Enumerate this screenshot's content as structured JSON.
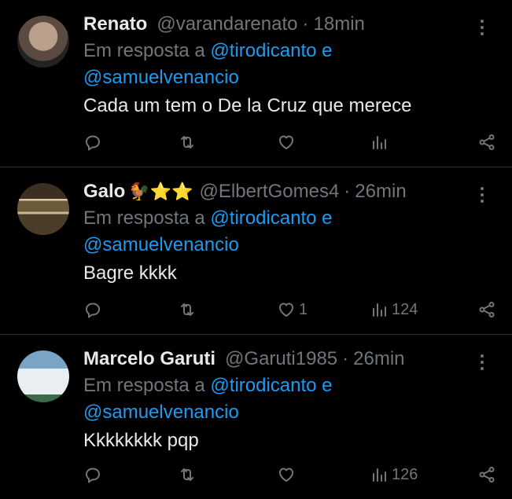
{
  "replies": [
    {
      "name": "Renato",
      "emoji": "",
      "handle": "@varandarenato",
      "sep": "·",
      "time": "18min",
      "replying_prefix": "Em resposta a",
      "mention1": "@tirodicanto",
      "conj": "e",
      "mention2": "@samuelvenancio",
      "text": "Cada um tem o De la Cruz que merece",
      "likes": "",
      "views": ""
    },
    {
      "name": "Galo",
      "emoji": "🐓⭐⭐",
      "handle": "@ElbertGomes4",
      "sep": "·",
      "time": "26min",
      "replying_prefix": "Em resposta a",
      "mention1": "@tirodicanto",
      "conj": "e",
      "mention2": "@samuelvenancio",
      "text": "Bagre kkkk",
      "likes": "1",
      "views": "124"
    },
    {
      "name": "Marcelo Garuti",
      "emoji": "",
      "handle": "@Garuti1985",
      "sep": "·",
      "time": "26min",
      "replying_prefix": "Em resposta a",
      "mention1": "@tirodicanto",
      "conj": "e",
      "mention2": "@samuelvenancio",
      "text": "Kkkkkkkk pqp",
      "likes": "",
      "views": "126"
    }
  ],
  "icons": {
    "reply": "reply-icon",
    "retweet": "retweet-icon",
    "like": "heart-icon",
    "views": "views-icon",
    "share": "share-icon",
    "more": "more-icon"
  },
  "colors": {
    "background": "#000000",
    "text": "#e7e9ea",
    "muted": "#71767b",
    "link": "#1d9bf0",
    "divider": "#2f3336"
  }
}
